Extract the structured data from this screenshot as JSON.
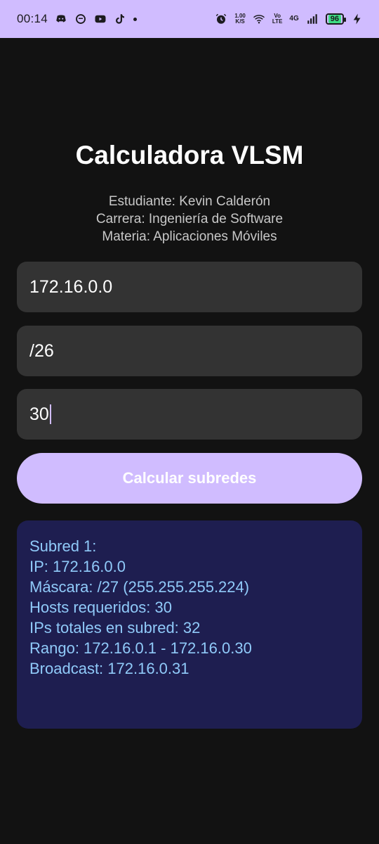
{
  "status_bar": {
    "time": "00:14",
    "net_speed": "1.00\nK/S",
    "volte": "Vo\nLTE",
    "network": "4G",
    "battery": "96",
    "icons": [
      "discord-icon",
      "chat-icon",
      "youtube-icon",
      "tiktok-icon",
      "alarm-icon",
      "wifi-icon",
      "signal-icon",
      "charging-icon"
    ]
  },
  "header": {
    "title": "Calculadora VLSM",
    "student": "Estudiante: Kevin Calderón",
    "career": "Carrera: Ingeniería de Software",
    "subject": "Materia: Aplicaciones Móviles"
  },
  "form": {
    "ip_value": "172.16.0.0",
    "prefix_value": "/26",
    "hosts_value": "30",
    "calc_button_label": "Calcular subredes"
  },
  "result": {
    "lines": [
      "Subred 1:",
      "IP: 172.16.0.0",
      "Máscara: /27 (255.255.255.224)",
      "Hosts requeridos: 30",
      "IPs totales en subred: 32",
      "Rango: 172.16.0.1 - 172.16.0.30",
      "Broadcast: 172.16.0.31"
    ]
  },
  "colors": {
    "status_bar_bg": "#d0bcff",
    "background": "#121212",
    "field_bg": "#333333",
    "button_bg": "#d0bcff",
    "result_bg": "#1e1e50",
    "result_text": "#90caf9"
  }
}
